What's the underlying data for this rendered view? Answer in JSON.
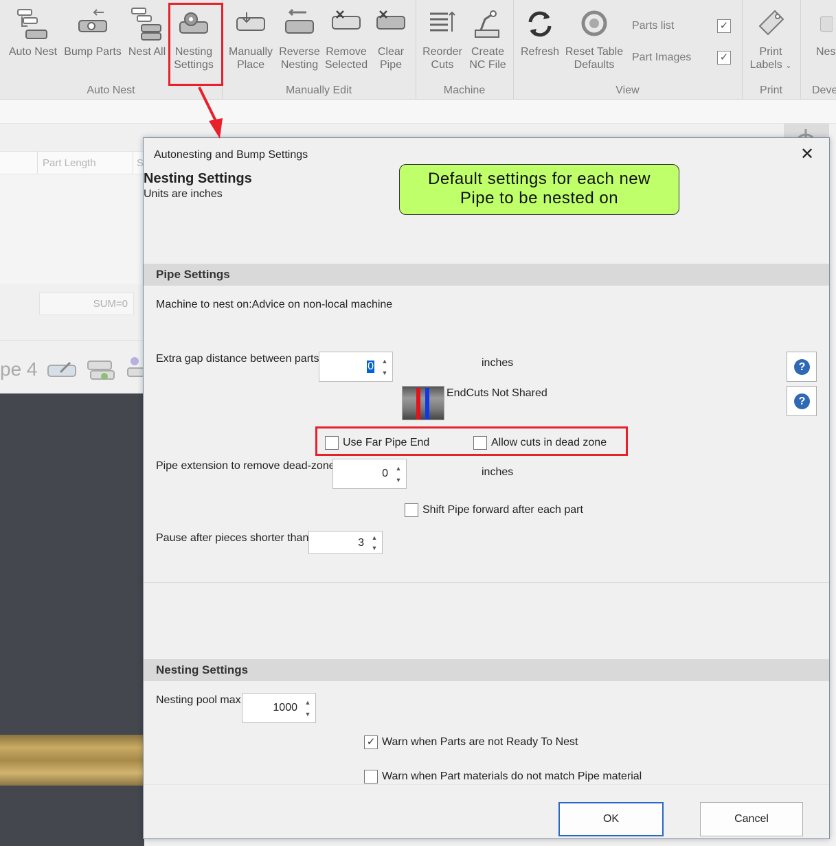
{
  "ribbon": {
    "buttons": {
      "auto_nest": "Auto Nest",
      "bump_parts": "Bump Parts",
      "nest_all": "Nest All",
      "nesting_settings_1": "Nesting",
      "nesting_settings_2": "Settings",
      "manually_place_1": "Manually",
      "manually_place_2": "Place",
      "reverse_nesting_1": "Reverse",
      "reverse_nesting_2": "Nesting",
      "remove_selected_1": "Remove",
      "remove_selected_2": "Selected",
      "clear_pipe_1": "Clear",
      "clear_pipe_2": "Pipe",
      "reorder_cuts_1": "Reorder",
      "reorder_cuts_2": "Cuts",
      "create_nc_1": "Create",
      "create_nc_2": "NC File",
      "refresh": "Refresh",
      "reset_table_1": "Reset Table",
      "reset_table_2": "Defaults",
      "print_labels_1": "Print",
      "print_labels_2": "Labels",
      "nest_partial": "Nest"
    },
    "view_items": {
      "parts_list": "Parts list",
      "part_images": "Part Images",
      "parts_list_checked": "✓",
      "part_images_checked": "✓"
    },
    "groups": {
      "auto_nest": "Auto Nest",
      "manually_edit": "Manually Edit",
      "machine": "Machine",
      "view": "View",
      "print": "Print",
      "deve": "Deve"
    }
  },
  "background": {
    "column_part_length": "Part Length",
    "column_s": "S",
    "sum": "SUM=0",
    "tab_label": "pe 4"
  },
  "dialog": {
    "title": "Autonesting and Bump Settings",
    "close_glyph": "✕",
    "heading": "Nesting Settings",
    "subheading": "Units are inches",
    "callout_line1": "Default settings for each new",
    "callout_line2": "Pipe to be nested on",
    "pipe_settings": {
      "header": "Pipe Settings",
      "machine_label": "Machine to nest on:Advice on non-local machine",
      "extra_gap_label": "Extra gap distance between parts",
      "extra_gap_value": "0",
      "extra_gap_unit": "inches",
      "endcuts_label": "EndCuts Not Shared",
      "use_far_pipe_end": "Use Far Pipe End",
      "allow_cuts_dead_zone": "Allow cuts in dead zone",
      "pipe_extension_label": "Pipe extension to remove dead-zone",
      "pipe_extension_value": "0",
      "pipe_extension_unit": "inches",
      "shift_pipe_label": "Shift Pipe forward after each part",
      "pause_label": "Pause after pieces shorter than",
      "pause_value": "3",
      "help_glyph": "?"
    },
    "nesting_settings": {
      "header": "Nesting Settings",
      "pool_max_label": "Nesting pool max:",
      "pool_max_value": "1000",
      "warn_not_ready": "Warn when Parts are not Ready To Nest",
      "warn_not_ready_checked": "✓",
      "warn_material": "Warn when Part materials do not match Pipe material"
    },
    "buttons": {
      "ok": "OK",
      "cancel": "Cancel"
    }
  },
  "spinner_glyphs": {
    "up": "▲",
    "down": "▼"
  },
  "colors": {
    "highlight": "#e8202a",
    "callout": "#bfff6a",
    "help": "#2f69b5",
    "primary_border": "#2b68c2"
  }
}
